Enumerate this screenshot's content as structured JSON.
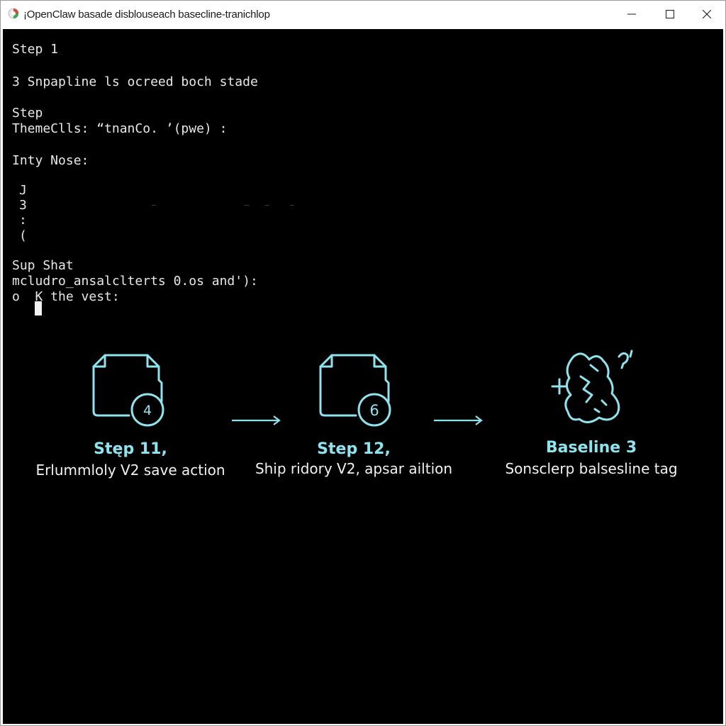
{
  "window": {
    "title": "¡OpenClaw basade disblouseach basecline-tranichlop",
    "icon": "app-icon",
    "controls": {
      "minimize": "minimize-icon",
      "maximize": "maximize-icon",
      "close": "close-icon"
    }
  },
  "terminal": {
    "lines": [
      "Step 1",
      "3 Snpapline ls ocreed boch stade",
      "Step",
      "ThemeClls: “tnanCo. ’(pwe) :",
      "Inty Nose:",
      "J",
      "3",
      ":",
      "(",
      "Sup Shat",
      "mcludro_ansalclterts 0.os and'):",
      "o  K the vest:"
    ]
  },
  "flow": {
    "steps": [
      {
        "icon": "document-badge-icon",
        "badge": "4",
        "title": "Stęp 11,",
        "description": "Erlummloly V2 save action"
      },
      {
        "icon": "document-badge-icon",
        "badge": "6",
        "title": "Step 12,",
        "description": "Ship ridory V2, apsar ailtion"
      },
      {
        "icon": "baseline-blob-icon",
        "badge": "",
        "title": "Baseline 3",
        "description": "Sonsclerp balsesline tag"
      }
    ],
    "arrows": [
      "arrow-right-icon",
      "arrow-right-icon"
    ]
  },
  "colors": {
    "terminal_bg": "#000000",
    "terminal_text": "#e8e8e8",
    "accent": "#8fe3ee",
    "titlebar_bg": "#ffffff"
  }
}
